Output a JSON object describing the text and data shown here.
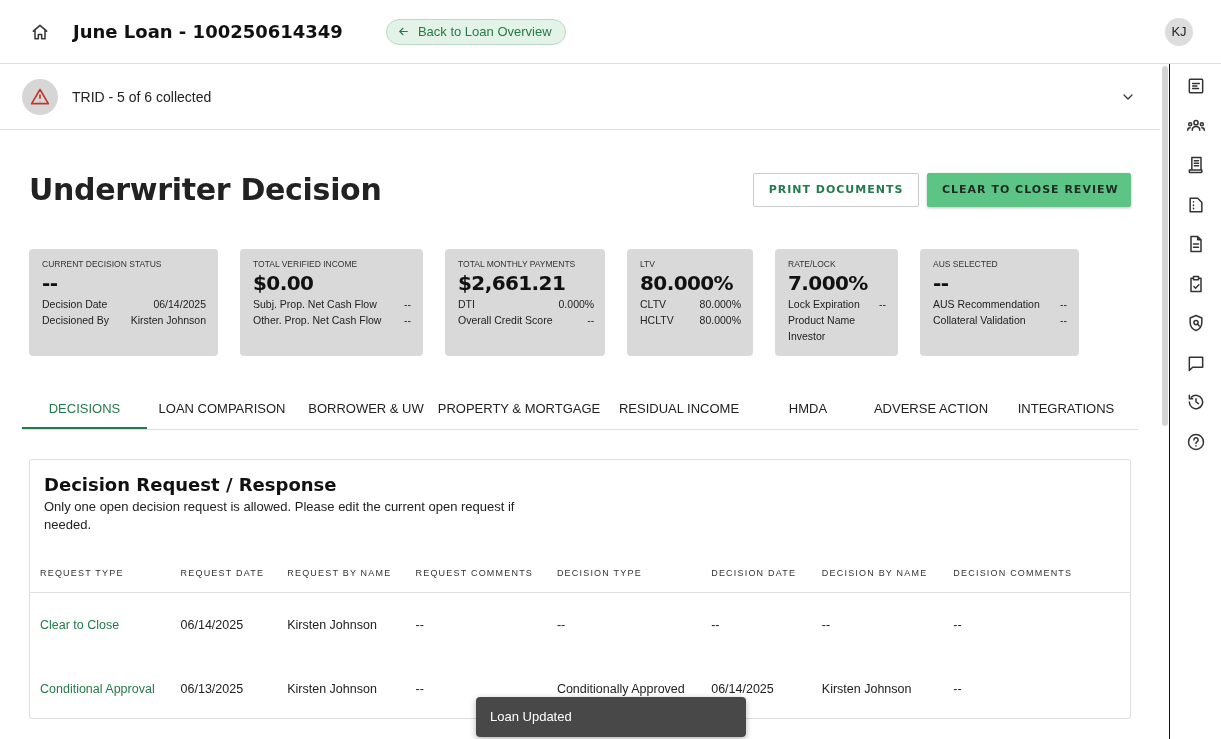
{
  "header": {
    "title": "June Loan - 100250614349",
    "back_link": "Back to Loan Overview",
    "avatar": "KJ"
  },
  "trid": {
    "text": "TRID - 5 of 6 collected"
  },
  "page_title": "Underwriter Decision",
  "actions": [
    {
      "label": "PRINT DOCUMENTS",
      "kind": "outline"
    },
    {
      "label": "CLEAR TO CLOSE REVIEW",
      "kind": "primary"
    }
  ],
  "cards": [
    {
      "title": "CURRENT DECISION STATUS",
      "value": "--",
      "details": [
        {
          "label": "Decision Date",
          "value": "06/14/2025"
        },
        {
          "label": "Decisioned By",
          "value": "Kirsten Johnson"
        }
      ]
    },
    {
      "title": "TOTAL VERIFIED INCOME",
      "value": "$0.00",
      "details": [
        {
          "label": "Subj. Prop. Net Cash Flow",
          "value": "--"
        },
        {
          "label": "Other. Prop. Net Cash Flow",
          "value": "--"
        }
      ]
    },
    {
      "title": "TOTAL MONTHLY PAYMENTS",
      "value": "$2,661.21",
      "details": [
        {
          "label": "DTI",
          "value": "0.000%"
        },
        {
          "label": "Overall Credit Score",
          "value": "--"
        }
      ]
    },
    {
      "title": "LTV",
      "value": "80.000%",
      "details": [
        {
          "label": "CLTV",
          "value": "80.000%"
        },
        {
          "label": "HCLTV",
          "value": "80.000%"
        }
      ]
    },
    {
      "title": "RATE/LOCK",
      "value": "7.000%",
      "details": [
        {
          "label": "Lock Expiration",
          "value": "--"
        },
        {
          "label": "Product Name"
        },
        {
          "label": "Investor"
        }
      ]
    },
    {
      "title": "AUS SELECTED",
      "value": "--",
      "details": [
        {
          "label": "AUS Recommendation",
          "value": "--"
        },
        {
          "label": "Collateral Validation",
          "value": "--"
        }
      ]
    }
  ],
  "tabs": [
    {
      "label": "DECISIONS",
      "selected": true
    },
    {
      "label": "LOAN COMPARISON",
      "selected": false
    },
    {
      "label": "BORROWER & UW",
      "selected": false
    },
    {
      "label": "PROPERTY & MORTGAGE",
      "selected": false
    },
    {
      "label": "RESIDUAL INCOME",
      "selected": false
    },
    {
      "label": "HMDA",
      "selected": false
    },
    {
      "label": "ADVERSE ACTION",
      "selected": false
    },
    {
      "label": "INTEGRATIONS",
      "selected": false
    }
  ],
  "decision_panel": {
    "title": "Decision Request / Response",
    "note": "Only one open decision request is allowed. Please edit the current open request if needed.",
    "columns": [
      "REQUEST TYPE",
      "REQUEST DATE",
      "REQUEST BY NAME",
      "REQUEST COMMENTS",
      "DECISION TYPE",
      "DECISION DATE",
      "DECISION BY NAME",
      "DECISION COMMENTS"
    ],
    "rows": [
      [
        "Clear to Close",
        "06/14/2025",
        "Kirsten Johnson",
        "--",
        "--",
        "--",
        "--",
        "--"
      ],
      [
        "Conditional Approval",
        "06/13/2025",
        "Kirsten Johnson",
        "--",
        "Conditionally Approved",
        "06/14/2025",
        "Kirsten Johnson",
        "--"
      ]
    ]
  },
  "toast": {
    "text": "Loan Updated"
  }
}
